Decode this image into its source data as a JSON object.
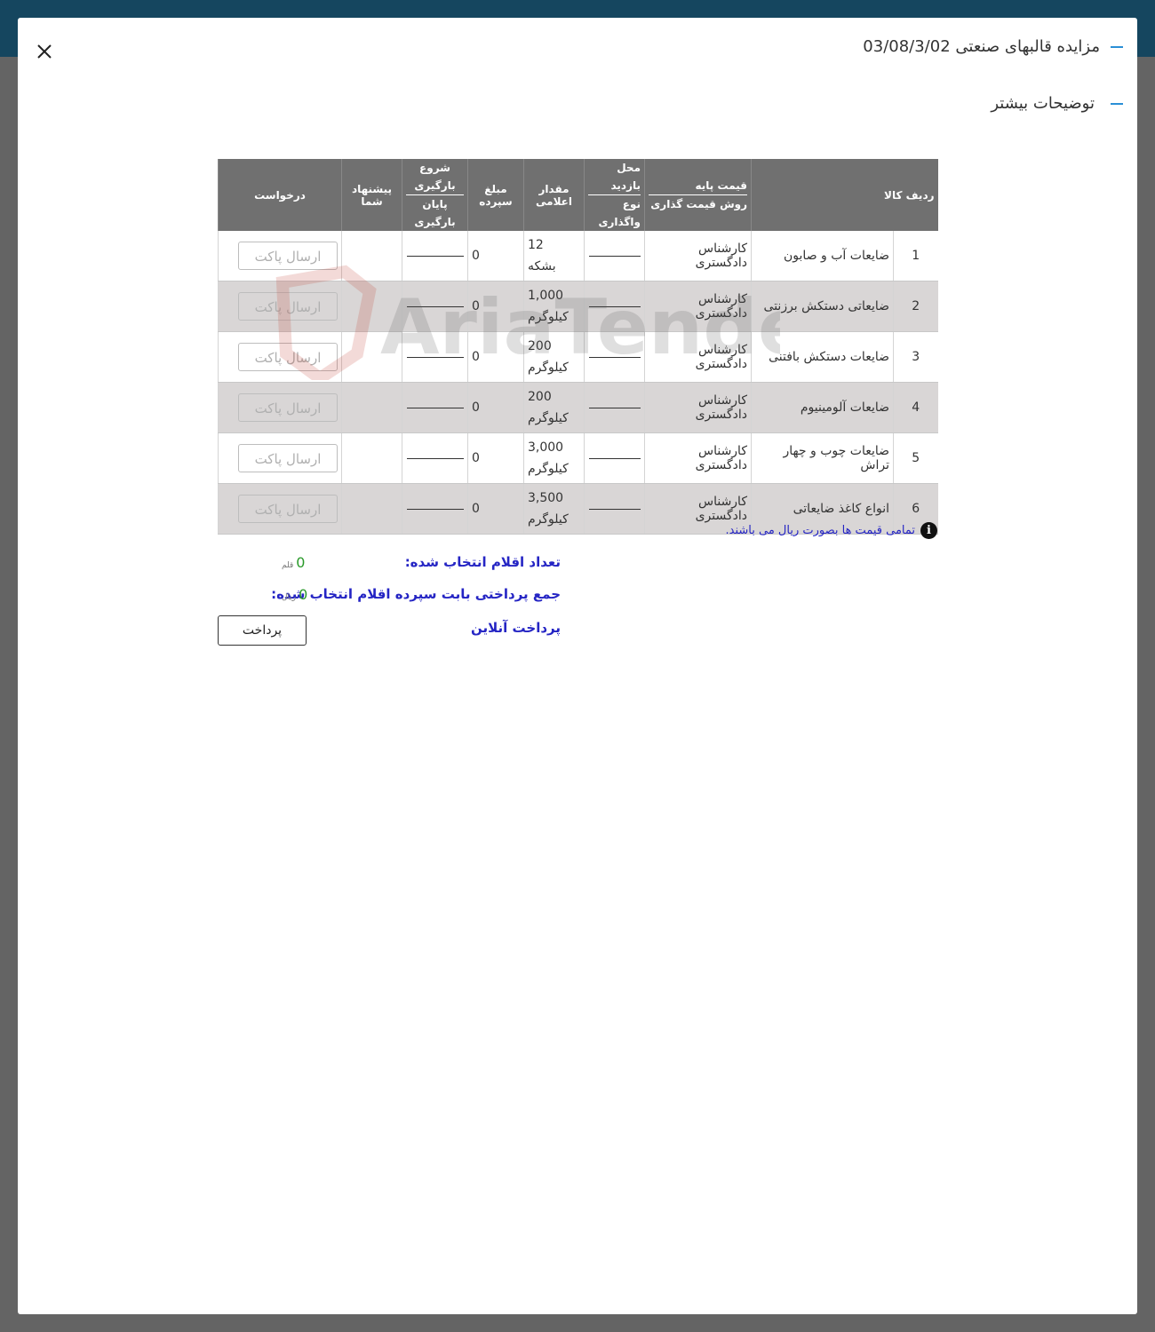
{
  "header": {
    "title": "مزایده قالبهای صنعتی 03/08/3/02",
    "more": "توضیحات بیشتر"
  },
  "table": {
    "headers": {
      "index": "ردیف",
      "item": "کالا",
      "base_price": "قیمت پایه",
      "pricing_method": "روش قیمت گذاری",
      "visit_place": "محل بازدید",
      "transfer_type": "نوع واگذاری",
      "quantity": "مقدار اعلامی",
      "deposit": "مبلغ سپرده",
      "load_start": "شروع بارگیری",
      "load_end": "پایان بارگیری",
      "your_offer": "پیشنهاد شما",
      "request": "درخواست"
    },
    "rows": [
      {
        "index": "1",
        "item": "ضایعات آب و صابون",
        "method": "کارشناس دادگستری",
        "qty": "12",
        "unit": "بشکه",
        "deposit": "0",
        "button": "ارسال پاکت"
      },
      {
        "index": "2",
        "item": "ضایعاتی دستکش برزنتی",
        "method": "کارشناس دادگستری",
        "qty": "1,000",
        "unit": "کیلوگرم",
        "deposit": "0",
        "button": "ارسال پاکت"
      },
      {
        "index": "3",
        "item": "ضایعات دستکش بافتنی",
        "method": "کارشناس دادگستری",
        "qty": "200",
        "unit": "کیلوگرم",
        "deposit": "0",
        "button": "ارسال پاکت"
      },
      {
        "index": "4",
        "item": "ضایعات آلومینیوم",
        "method": "کارشناس دادگستری",
        "qty": "200",
        "unit": "کیلوگرم",
        "deposit": "0",
        "button": "ارسال پاکت"
      },
      {
        "index": "5",
        "item": "ضایعات چوب و چهار تراش",
        "method": "کارشناس دادگستری",
        "qty": "3,000",
        "unit": "کیلوگرم",
        "deposit": "0",
        "button": "ارسال پاکت"
      },
      {
        "index": "6",
        "item": "انواع کاغذ ضایعاتی",
        "method": "کارشناس دادگستری",
        "qty": "3,500",
        "unit": "کیلوگرم",
        "deposit": "0",
        "button": "ارسال پاکت"
      }
    ]
  },
  "note": "تمامی قیمت ها بصورت ریال می باشند.",
  "summary": {
    "selected_label": "تعداد اقلام انتخاب شده:",
    "selected_value": "0",
    "selected_unit": "قلم",
    "total_label": "جمع پرداختی بابت سپرده اقلام انتخاب شده:",
    "total_value": "0",
    "total_unit": "ریال",
    "online_label": "پرداخت آنلاین",
    "pay_button": "پرداخت"
  },
  "watermark": "AriaTender.net",
  "icons": {
    "close": "close-icon",
    "info": "info-icon"
  }
}
